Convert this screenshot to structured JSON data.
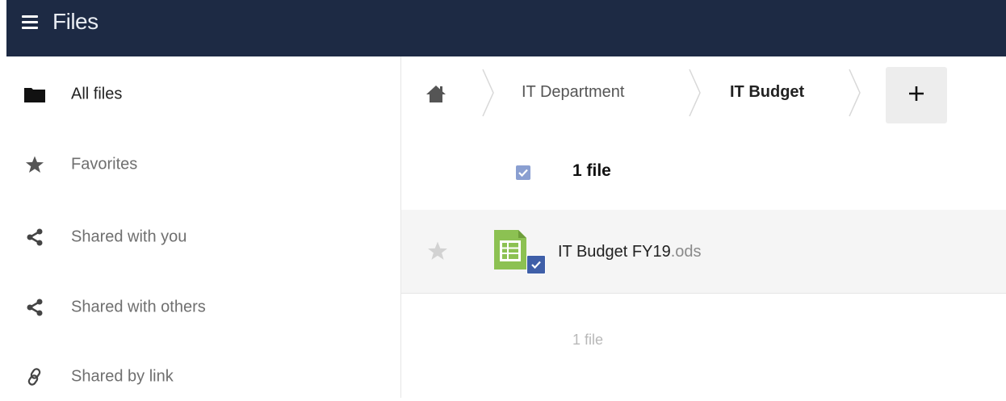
{
  "header": {
    "title": "Files",
    "menu_icon": "hamburger-icon"
  },
  "sidebar": {
    "items": [
      {
        "label": "All files",
        "icon": "folder-icon",
        "active": true
      },
      {
        "label": "Favorites",
        "icon": "star-icon",
        "active": false
      },
      {
        "label": "Shared with you",
        "icon": "share-icon",
        "active": false
      },
      {
        "label": "Shared with others",
        "icon": "share-icon",
        "active": false
      },
      {
        "label": "Shared by link",
        "icon": "link-icon",
        "active": false
      }
    ]
  },
  "breadcrumb": {
    "home_icon": "home-icon",
    "items": [
      "IT Department",
      "IT Budget"
    ],
    "add_label": "+"
  },
  "file_list": {
    "header_count": "1 file",
    "files": [
      {
        "name": "IT Budget FY19",
        "extension": ".ods",
        "icon": "spreadsheet-icon",
        "favorite": false,
        "selected": true
      }
    ],
    "summary": "1 file"
  },
  "colors": {
    "topbar": "#1d2a44",
    "accent": "#3f5fa8",
    "spreadsheet": "#8cc152"
  }
}
